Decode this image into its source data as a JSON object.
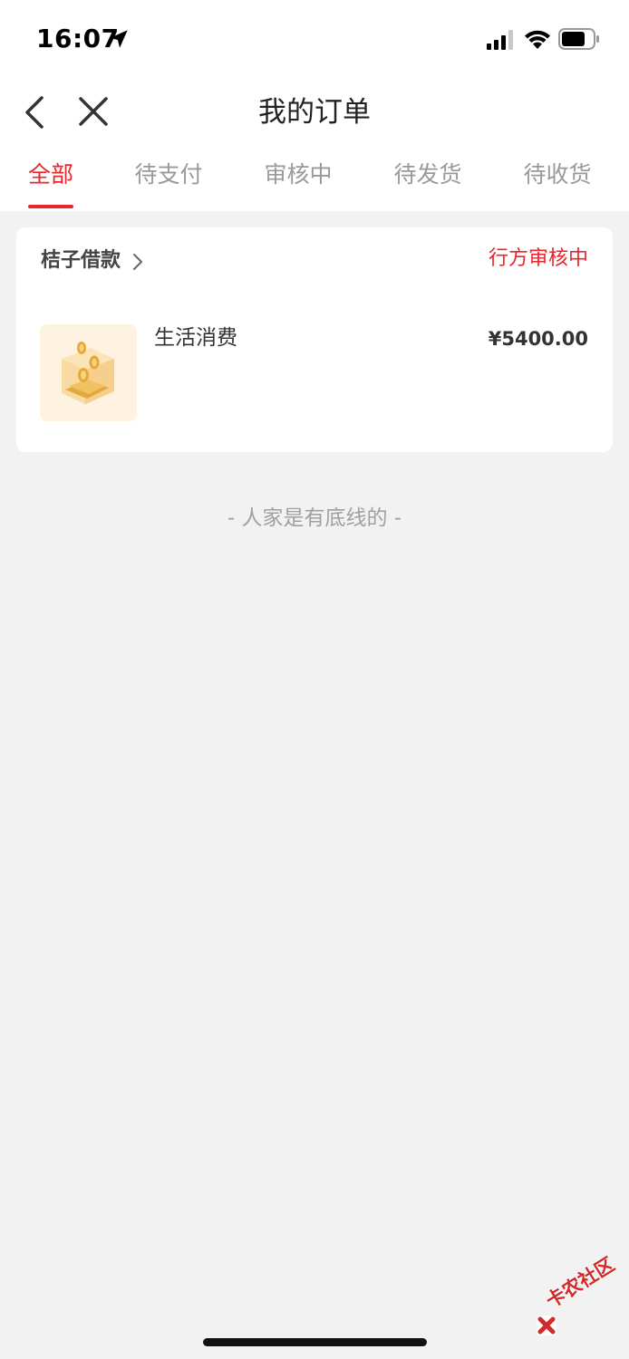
{
  "status_bar": {
    "time": "16:07",
    "icons": [
      "location-arrow-icon",
      "cellular-signal-icon",
      "wifi-icon",
      "battery-icon"
    ]
  },
  "nav": {
    "title": "我的订单",
    "back_icon": "chevron-left-icon",
    "close_icon": "close-icon"
  },
  "tabs": [
    {
      "label": "全部",
      "active": true
    },
    {
      "label": "待支付",
      "active": false
    },
    {
      "label": "审核中",
      "active": false
    },
    {
      "label": "待发货",
      "active": false
    },
    {
      "label": "待收货",
      "active": false
    }
  ],
  "order": {
    "shop_name": "桔子借款",
    "status": "行方审核中",
    "product_name": "生活消费",
    "price": "¥5400.00",
    "thumbnail_icon": "gold-coin-box-icon"
  },
  "footer_tip": "- 人家是有底线的 -",
  "watermark": {
    "text": "卡农社区",
    "logo_icon": "kanong-logo-icon"
  },
  "colors": {
    "accent": "#e8262b",
    "background": "#f2f2f2",
    "card": "#ffffff",
    "muted_text": "#999999"
  }
}
